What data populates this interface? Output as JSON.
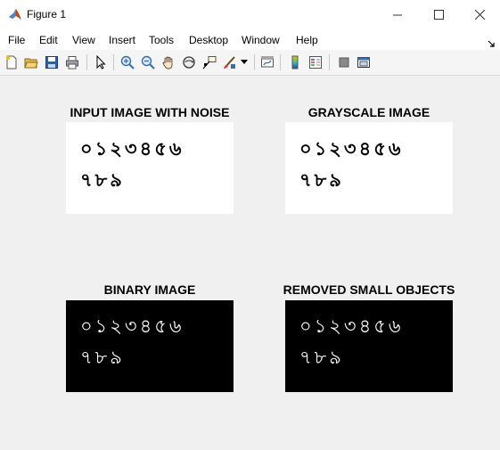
{
  "window": {
    "title": "Figure 1",
    "app_icon": "matlab-logo-icon",
    "controls": [
      "minimize-icon",
      "maximize-icon",
      "close-icon"
    ]
  },
  "menu": [
    "File",
    "Edit",
    "View",
    "Insert",
    "Tools",
    "Desktop",
    "Window",
    "Help"
  ],
  "toolbar": {
    "icons": [
      "new-figure-icon",
      "open-file-icon",
      "save-icon",
      "print-icon",
      "edit-plot-arrow-icon",
      "zoom-in-icon",
      "zoom-out-icon",
      "pan-hand-icon",
      "rotate-3d-icon",
      "data-cursor-icon",
      "brush-icon",
      "link-plot-icon",
      "insert-colorbar-icon",
      "insert-legend-icon",
      "hide-plot-tools-icon",
      "show-plot-tools-icon"
    ]
  },
  "axes": [
    {
      "title": "INPUT IMAGE WITH NOISE",
      "background": "#ffffff",
      "ink": "#000000"
    },
    {
      "title": "GRAYSCALE IMAGE",
      "background": "#ffffff",
      "ink": "#000000"
    },
    {
      "title": "BINARY IMAGE",
      "background": "#000000",
      "ink": "#ffffff"
    },
    {
      "title": "REMOVED SMALL OBJECTS",
      "background": "#000000",
      "ink": "#ffffff"
    }
  ],
  "image_text": {
    "row1": "০১২৩৪৫৬",
    "row2": "৭৮৯"
  }
}
